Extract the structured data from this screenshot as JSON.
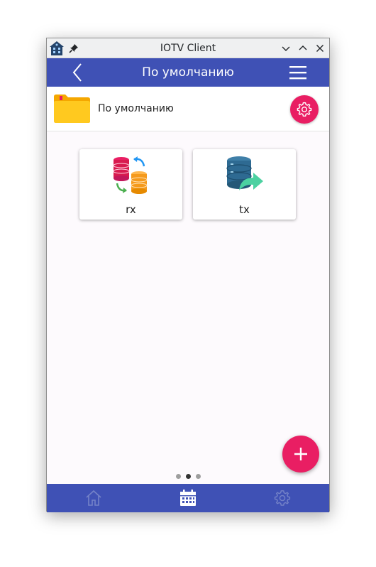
{
  "window": {
    "title": "IOTV Client",
    "controls": [
      "minimize",
      "maximize",
      "close"
    ]
  },
  "appbar": {
    "title": "По умолчанию",
    "back_icon": "chevron-left-icon",
    "menu_icon": "hamburger-menu-icon"
  },
  "folder": {
    "name": "По умолчанию",
    "icon": "folder-icon",
    "settings_icon": "gear-icon"
  },
  "devices": [
    {
      "label": "rx",
      "icon": "database-sync-icon"
    },
    {
      "label": "tx",
      "icon": "database-export-icon"
    }
  ],
  "fab": {
    "icon": "plus-icon"
  },
  "pager": {
    "count": 3,
    "active_index": 1
  },
  "bottom_nav": {
    "items": [
      {
        "icon": "home-icon",
        "active": false
      },
      {
        "icon": "calendar-icon",
        "active": true
      },
      {
        "icon": "gear-icon",
        "active": false
      }
    ]
  },
  "colors": {
    "primary": "#3f51b5",
    "accent": "#e91e63",
    "background": "#fdfafd",
    "folder": "#ffc107"
  }
}
